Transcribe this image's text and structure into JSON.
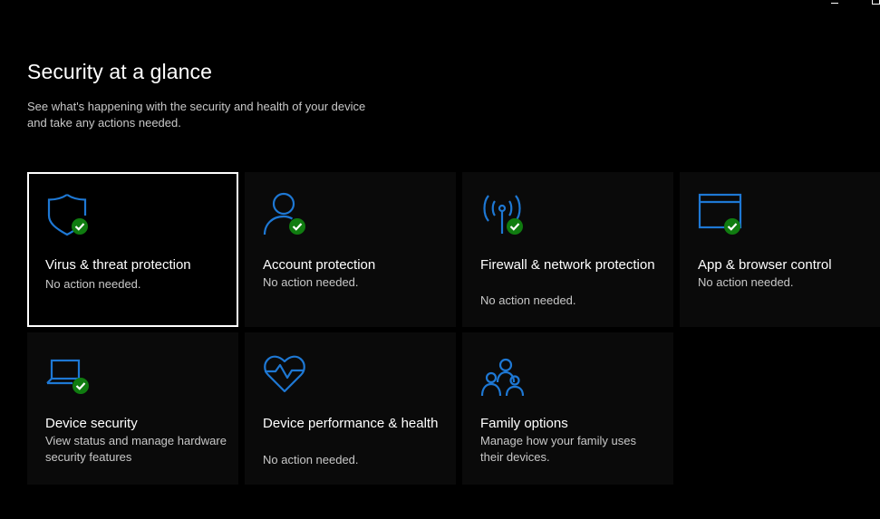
{
  "window": {
    "controls": [
      "minimize",
      "maximize"
    ]
  },
  "page": {
    "title": "Security at a glance",
    "description": "See what's happening with the security and health of your device and take any actions needed."
  },
  "colors": {
    "accent": "#1e78d4",
    "check": "#107c10",
    "tile_bg": "#0a0a0a"
  },
  "tiles": [
    {
      "icon": "shield-icon",
      "title": "Virus & threat protection",
      "status": "No action needed.",
      "check": true,
      "selected": true
    },
    {
      "icon": "person-icon",
      "title": "Account protection",
      "status": "No action needed.",
      "check": true
    },
    {
      "icon": "wifi-antenna-icon",
      "title": "Firewall & network protection",
      "status": "No action needed.",
      "check": true
    },
    {
      "icon": "browser-window-icon",
      "title": "App & browser control",
      "status": "No action needed.",
      "check": true
    },
    {
      "icon": "laptop-icon",
      "title": "Device security",
      "status": "View status and manage hardware security features",
      "check": true
    },
    {
      "icon": "heart-pulse-icon",
      "title": "Device performance & health",
      "status": "No action needed.",
      "check": false
    },
    {
      "icon": "family-icon",
      "title": "Family options",
      "status": "Manage how your family uses their devices.",
      "check": false
    }
  ]
}
